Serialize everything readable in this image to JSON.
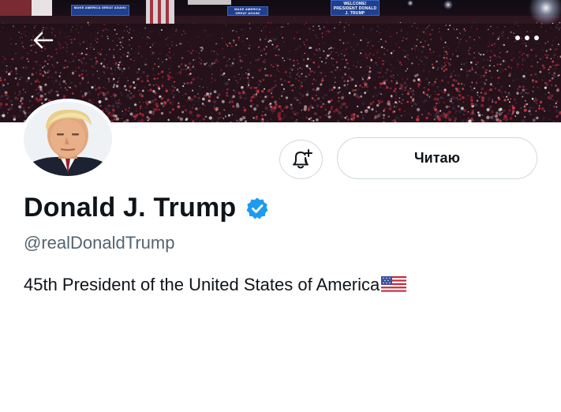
{
  "banner": {
    "signs": [
      "MAKE AMERICA GREAT AGAIN!",
      "MAKE AMERICA GREAT AGAIN!",
      "WELCOME! PRESIDENT DONALD J. TRUMP"
    ]
  },
  "header": {
    "back_icon": "arrow-left-icon",
    "more_icon": "more-horizontal-icon"
  },
  "actions": {
    "notify_icon": "bell-plus-icon",
    "follow_label": "Читаю"
  },
  "profile": {
    "name": "Donald J. Trump",
    "verified_icon": "verified-badge-icon",
    "handle": "@realDonaldTrump",
    "bio": "45th President of the United States of America",
    "bio_flag_icon": "us-flag-icon"
  },
  "colors": {
    "verified_blue": "#1d9bf0",
    "text_primary": "#0f1419",
    "text_secondary": "#536471",
    "border": "#cfd9de"
  }
}
